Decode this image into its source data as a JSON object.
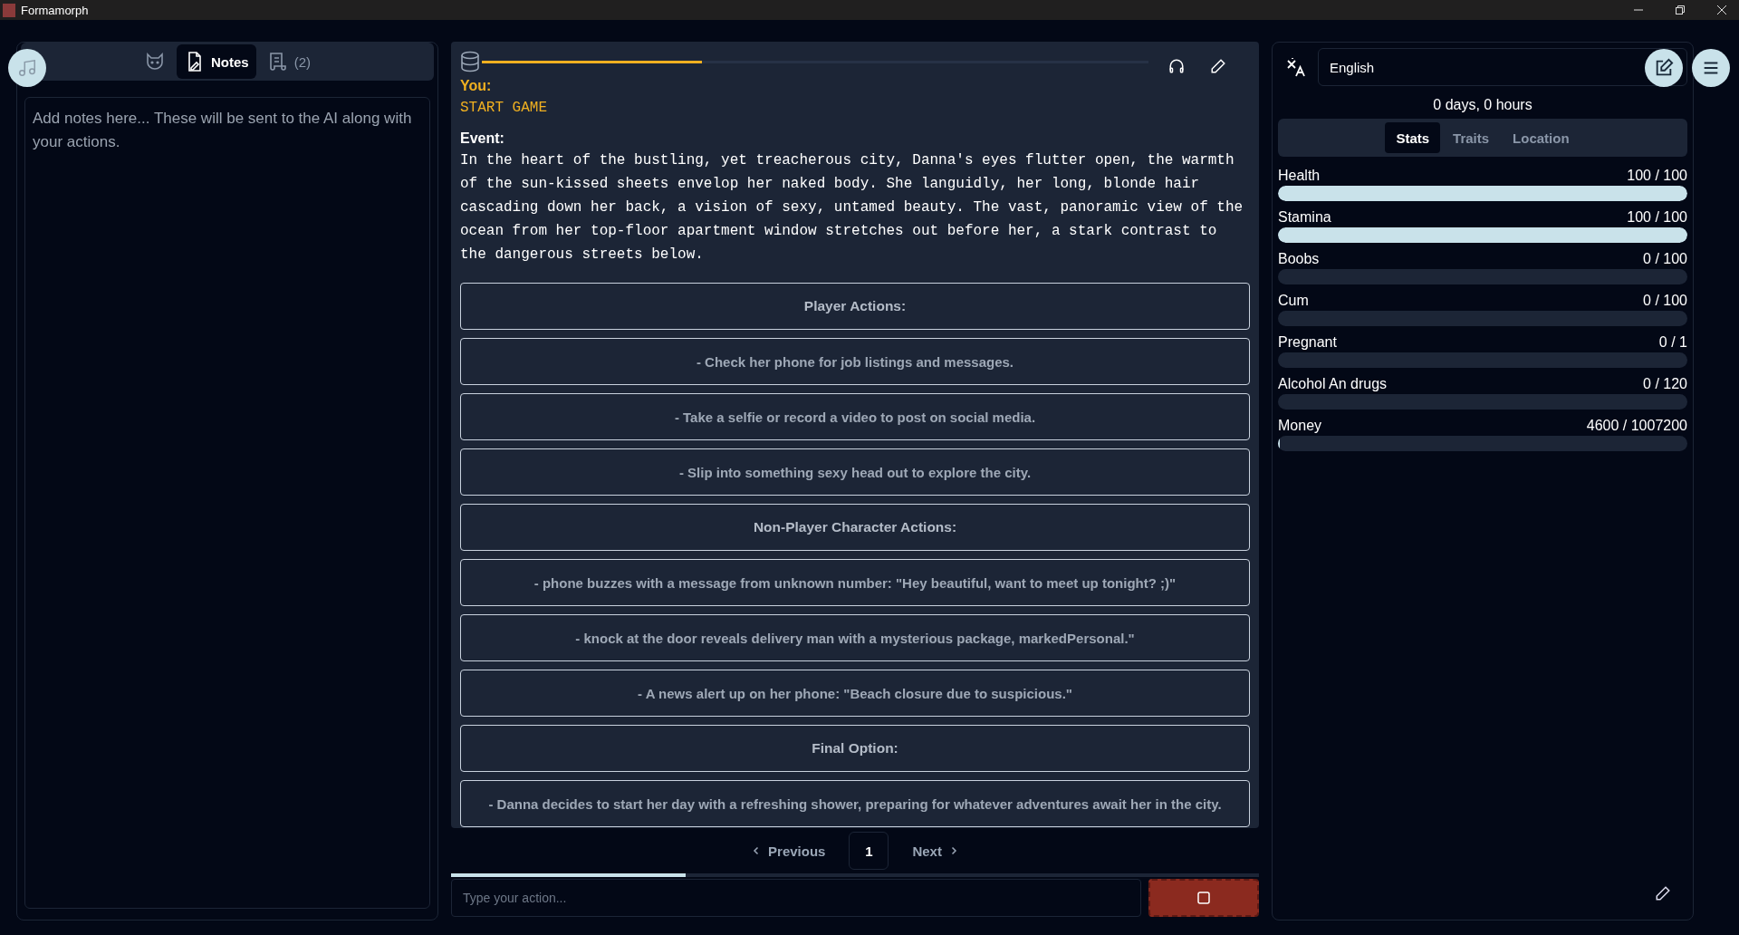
{
  "window": {
    "title": "Formamorph"
  },
  "left_panel": {
    "tabs": [
      {
        "kind": "cat",
        "selected": false
      },
      {
        "kind": "notes",
        "label": "Notes",
        "selected": true
      },
      {
        "kind": "scroll",
        "label": "(2)",
        "selected": false
      }
    ],
    "notes": {
      "placeholder": "Add notes here... These will be sent to the AI along with your actions."
    }
  },
  "story": {
    "loading": {
      "level": 0.33
    },
    "you_label": "You:",
    "you_text": "START GAME",
    "event_label": "Event:",
    "event_text": "In the heart of the bustling, yet treacherous city, Danna's eyes flutter open, the warmth of the sun-kissed sheets envelop her naked body. She languidly, her long, blonde hair cascading down her back, a vision of sexy, untamed beauty. The vast, panoramic view of the ocean from her top-floor apartment window stretches out before her, a stark contrast to the dangerous streets below.",
    "actions": [
      {
        "kind": "header",
        "text": "Player Actions:"
      },
      {
        "kind": "option",
        "text": "- Check her phone for job listings and messages."
      },
      {
        "kind": "option",
        "text": "- Take a selfie or record a video to post on social media."
      },
      {
        "kind": "option",
        "text": "- Slip into something sexy head out to explore the city."
      },
      {
        "kind": "header",
        "text": "Non-Player Character Actions:"
      },
      {
        "kind": "option",
        "text": "- phone buzzes with a message from unknown number: \"Hey beautiful, want to meet up tonight? ;)\""
      },
      {
        "kind": "option",
        "text": "- knock at the door reveals delivery man with a mysterious package, markedPersonal.\""
      },
      {
        "kind": "option",
        "text": "- A news alert up on her phone: \"Beach closure due to suspicious.\""
      },
      {
        "kind": "header",
        "text": "Final Option:"
      },
      {
        "kind": "option",
        "text": "- Danna decides to start her day with a refreshing shower, preparing for whatever adventures await her in the city."
      }
    ]
  },
  "pagination": {
    "previous": "Previous",
    "page": "1",
    "next": "Next"
  },
  "turn_progress": {
    "level": 0.29
  },
  "action_input": {
    "placeholder": "Type your action..."
  },
  "right_panel": {
    "language": "English",
    "time": "0 days, 0 hours",
    "tabs": [
      {
        "label": "Stats",
        "selected": true
      },
      {
        "label": "Traits",
        "selected": false
      },
      {
        "label": "Location",
        "selected": false
      }
    ],
    "stats": [
      {
        "name": "Health",
        "reading": "100 / 100",
        "level": 1
      },
      {
        "name": "Stamina",
        "reading": "100 / 100",
        "level": 1
      },
      {
        "name": "Boobs",
        "reading": "0 / 100",
        "level": 0
      },
      {
        "name": "Cum",
        "reading": "0 / 100",
        "level": 0
      },
      {
        "name": "Pregnant",
        "reading": "0 / 1",
        "level": 0
      },
      {
        "name": "Alcohol An drugs",
        "reading": "0 / 120",
        "level": 0
      },
      {
        "name": "Money",
        "reading": "4600 / 1007200",
        "level": 0.005
      }
    ]
  }
}
